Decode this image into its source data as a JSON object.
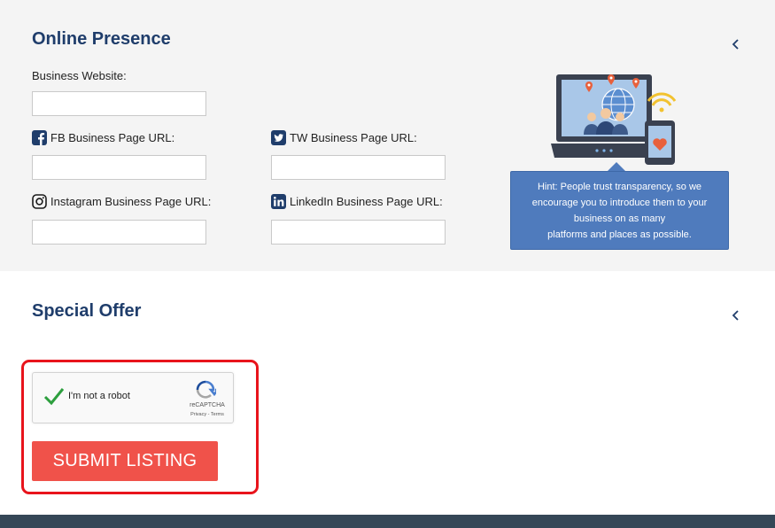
{
  "online_presence": {
    "title": "Online Presence",
    "fields": {
      "website": {
        "label": "Business Website:",
        "value": ""
      },
      "facebook": {
        "label": "FB Business Page URL:",
        "value": "",
        "icon": "facebook-icon"
      },
      "twitter": {
        "label": "TW Business Page URL:",
        "value": "",
        "icon": "twitter-icon"
      },
      "instagram": {
        "label": "Instagram Business Page URL:",
        "value": "",
        "icon": "instagram-icon"
      },
      "linkedin": {
        "label": "LinkedIn Business Page URL:",
        "value": "",
        "icon": "linkedin-icon"
      }
    },
    "hint": {
      "line1": "Hint: People trust transparency, so we",
      "line2": "encourage you to introduce them to your",
      "line3": "business on as many",
      "line4": "platforms and places as possible."
    },
    "collapse_icon": "chevron-left-icon"
  },
  "special_offer": {
    "title": "Special Offer",
    "collapse_icon": "chevron-left-icon"
  },
  "recaptcha": {
    "label": "I'm not a robot",
    "brand": "reCAPTCHA",
    "privacy": "Privacy",
    "separator": "-",
    "terms": "Terms",
    "checked": true
  },
  "submit": {
    "label": "SUBMIT LISTING"
  },
  "colors": {
    "title": "#1f3d6b",
    "hint_bg": "#4f7bbd",
    "submit_bg": "#f0524a",
    "highlight": "#e8141c",
    "footer": "#354757",
    "check": "#2d9f3e"
  }
}
